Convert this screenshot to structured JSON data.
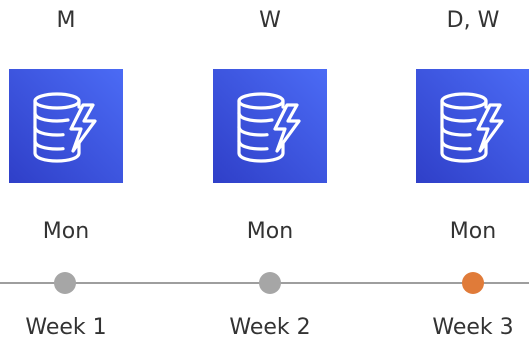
{
  "columns": [
    {
      "top_label": "M",
      "day_label": "Mon",
      "week_label": "Week 1",
      "dot_color": "#a6a6a6"
    },
    {
      "top_label": "W",
      "day_label": "Mon",
      "week_label": "Week 2",
      "dot_color": "#a6a6a6"
    },
    {
      "top_label": "D, W",
      "day_label": "Mon",
      "week_label": "Week 3",
      "dot_color": "#e07b39"
    }
  ],
  "icon": {
    "name": "dynamodb-icon",
    "tile_color_start": "#4b6bf5",
    "tile_color_end": "#2f3fc8"
  },
  "timeline_color": "#9e9e9e"
}
